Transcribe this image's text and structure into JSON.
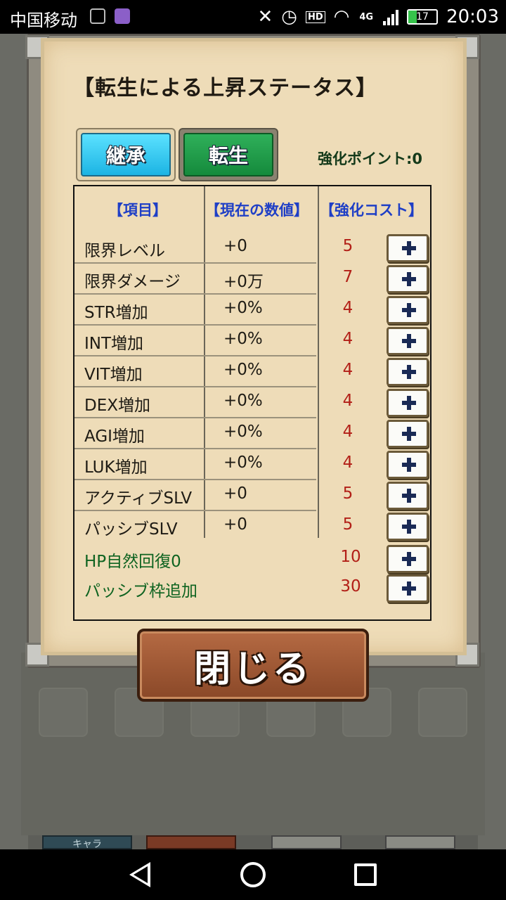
{
  "status_bar": {
    "carrier": "中国移动",
    "hd": "HD",
    "network": "4G",
    "battery": "17",
    "time": "20:03"
  },
  "dialog": {
    "title": "【転生による上昇ステータス】",
    "tabs": [
      {
        "label": "継承",
        "color": "#1cb4e3"
      },
      {
        "label": "転生",
        "color": "#158a3c"
      }
    ],
    "points_label": "強化ポイント:0",
    "headers": [
      "【項目】",
      "【現在の数値】",
      "【強化コスト】"
    ],
    "rows": [
      {
        "name": "限界レベル",
        "value": "+0",
        "cost": "5"
      },
      {
        "name": "限界ダメージ",
        "value": "+0万",
        "cost": "7"
      },
      {
        "name": "STR増加",
        "value": "+0%",
        "cost": "4"
      },
      {
        "name": "INT増加",
        "value": "+0%",
        "cost": "4"
      },
      {
        "name": "VIT増加",
        "value": "+0%",
        "cost": "4"
      },
      {
        "name": "DEX増加",
        "value": "+0%",
        "cost": "4"
      },
      {
        "name": "AGI増加",
        "value": "+0%",
        "cost": "4"
      },
      {
        "name": "LUK増加",
        "value": "+0%",
        "cost": "4"
      },
      {
        "name": "アクティブSLV",
        "value": "+0",
        "cost": "5"
      },
      {
        "name": "パッシブSLV",
        "value": "+0",
        "cost": "5"
      }
    ],
    "extra_rows": [
      {
        "name": "HP自然回復0",
        "cost": "10"
      },
      {
        "name": "パッシブ枠追加",
        "cost": "30"
      }
    ],
    "close_label": "閉じる"
  },
  "background": {
    "bottom_tab_label": "キャラ"
  },
  "colors": {
    "parchment": "#eedcb8",
    "header_blue": "#1f3fc6",
    "cost_red": "#b21f17",
    "extra_green": "#0e6320"
  }
}
